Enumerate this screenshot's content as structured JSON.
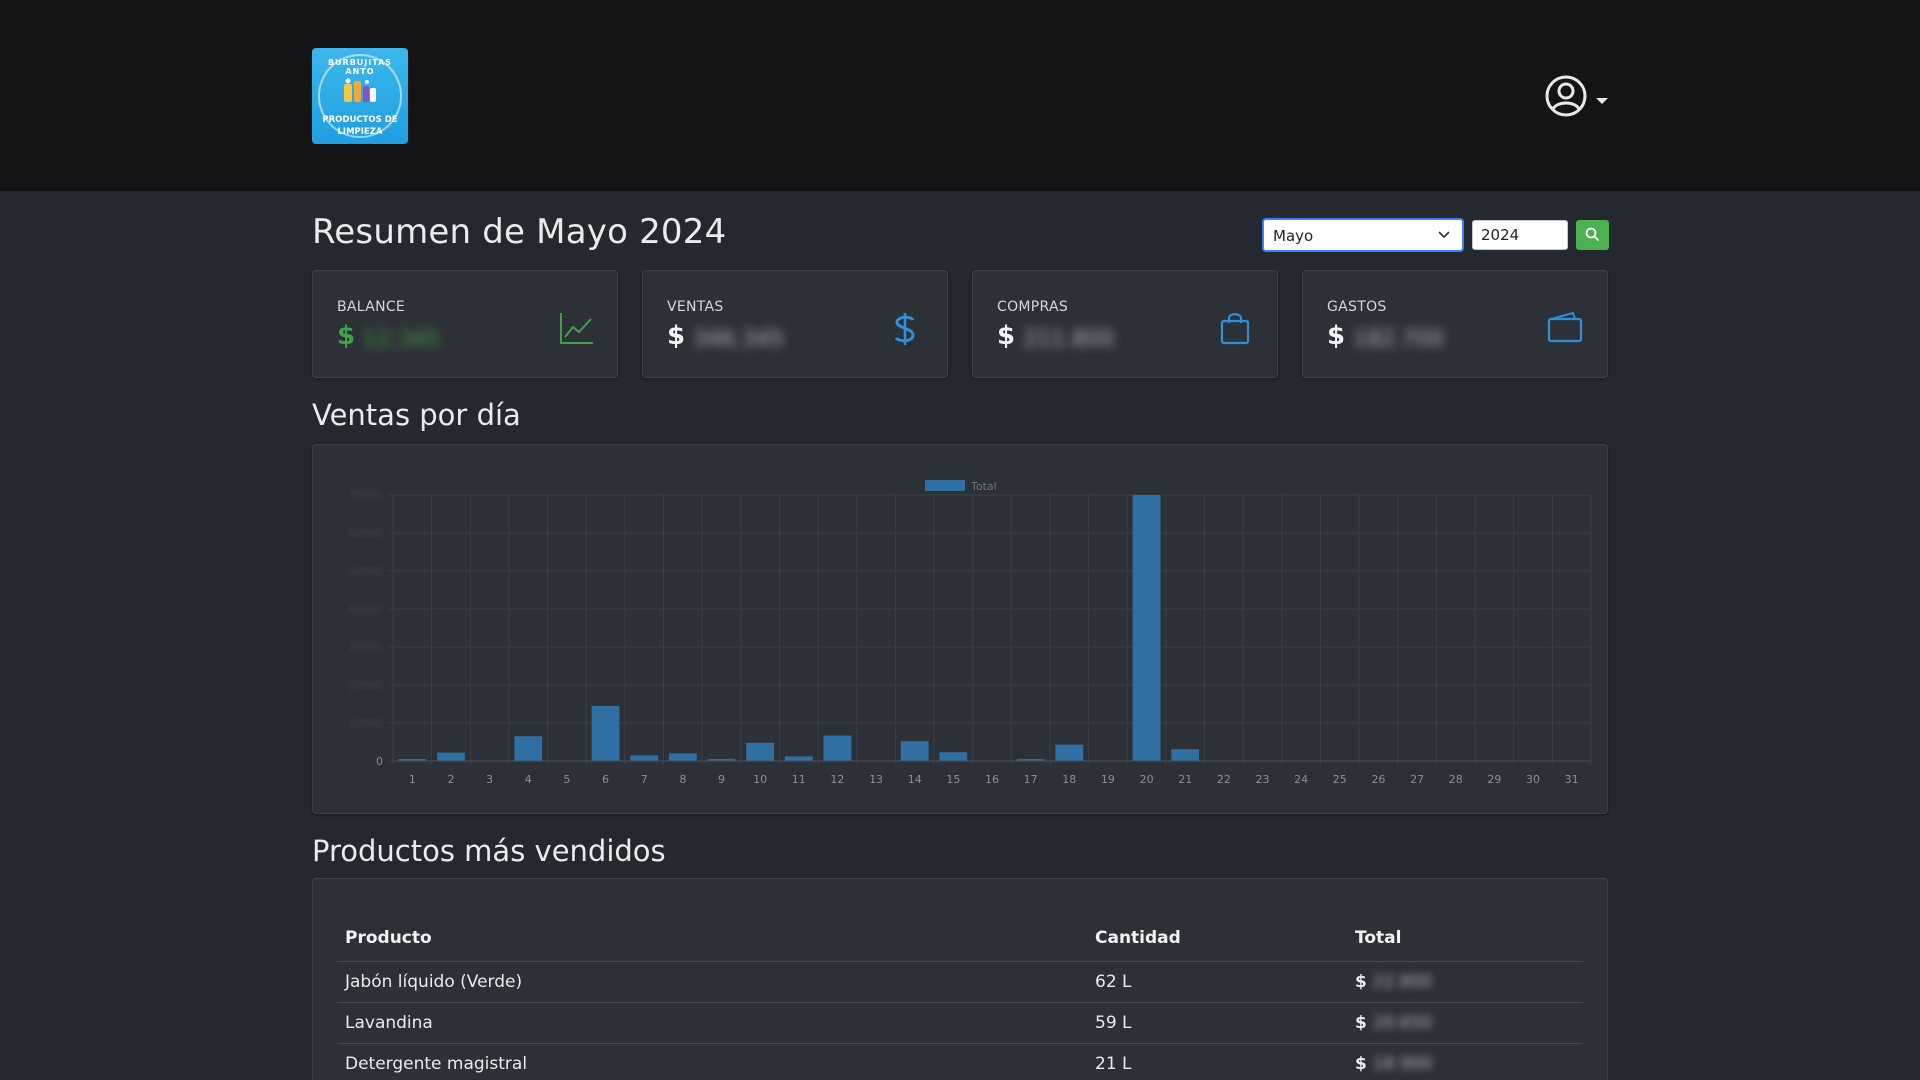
{
  "loading_bar": {
    "progress": 0.2
  },
  "header": {
    "logo": {
      "line1": "BURBUJITAS ANTO",
      "line2": "PRODUCTOS DE",
      "line3": "LIMPIEZA"
    },
    "user_icon": "user-circle-icon"
  },
  "page": {
    "title": "Resumen de Mayo 2024",
    "month_selected": "Mayo",
    "year_value": "2024",
    "search_icon": "search-icon"
  },
  "cards": [
    {
      "label": "BALANCE",
      "currency": "$",
      "value": "12.345",
      "icon": "chart-line-icon",
      "color": "#43a047"
    },
    {
      "label": "VENTAS",
      "currency": "$",
      "value": "346.345",
      "icon": "dollar-icon",
      "color": "#2f8fd8"
    },
    {
      "label": "COMPRAS",
      "currency": "$",
      "value": "211.800",
      "icon": "shopping-bag-icon",
      "color": "#2f8fd8"
    },
    {
      "label": "GASTOS",
      "currency": "$",
      "value": "182.700",
      "icon": "wallet-icon",
      "color": "#2f8fd8"
    }
  ],
  "sales_section": {
    "title": "Ventas por día"
  },
  "chart_data": {
    "type": "bar",
    "legend": [
      "Total"
    ],
    "legend_position": "top",
    "categories": [
      "1",
      "2",
      "3",
      "4",
      "5",
      "6",
      "7",
      "8",
      "9",
      "10",
      "11",
      "12",
      "13",
      "14",
      "15",
      "16",
      "17",
      "18",
      "19",
      "20",
      "21",
      "22",
      "23",
      "24",
      "25",
      "26",
      "27",
      "28",
      "29",
      "30",
      "31"
    ],
    "series": [
      {
        "name": "Total",
        "color": "#2f6fa3",
        "values": [
          500,
          2200,
          0,
          6500,
          0,
          14500,
          1500,
          2000,
          500,
          4800,
          1200,
          6700,
          0,
          5200,
          2300,
          0,
          500,
          4300,
          0,
          70000,
          3100,
          0,
          0,
          0,
          0,
          0,
          0,
          0,
          0,
          0,
          0
        ]
      }
    ],
    "ylim": [
      0,
      70000
    ],
    "yticks": [
      "0",
      "10000",
      "20000",
      "30000",
      "40000",
      "50000",
      "60000",
      "70000"
    ],
    "grid": true
  },
  "products_section": {
    "title": "Productos más vendidos",
    "columns": [
      "Producto",
      "Cantidad",
      "Total"
    ],
    "rows": [
      {
        "product": "Jabón líquido (Verde)",
        "qty": "62 L",
        "currency": "$",
        "total": "22.800"
      },
      {
        "product": "Lavandina",
        "qty": "59 L",
        "currency": "$",
        "total": "20.650"
      },
      {
        "product": "Detergente magistral",
        "qty": "21 L",
        "currency": "$",
        "total": "18.900"
      }
    ]
  }
}
